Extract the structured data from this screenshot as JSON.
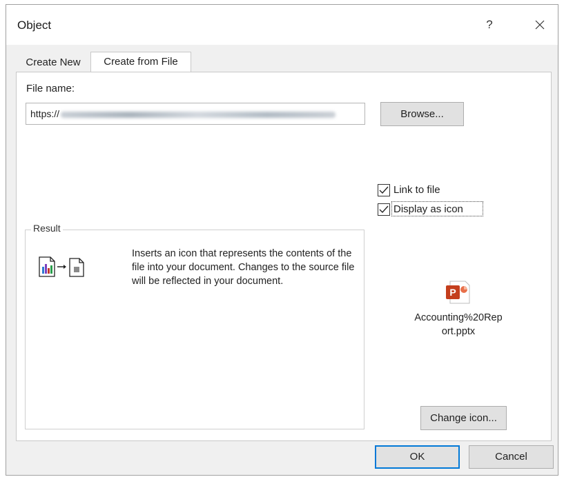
{
  "window": {
    "title": "Object",
    "help_label": "?"
  },
  "tabs": [
    {
      "label": "Create New",
      "selected": false
    },
    {
      "label": "Create from File",
      "selected": true
    }
  ],
  "file": {
    "label": "File name:",
    "value_visible": "https://",
    "browse_label": "Browse..."
  },
  "options": {
    "link_to_file": {
      "label": "Link to file",
      "checked": true
    },
    "display_as_icon": {
      "label": "Display as icon",
      "checked": true
    }
  },
  "result": {
    "label": "Result",
    "description": "Inserts an icon that represents the contents of the file into your document. Changes to the source file will be reflected in your document."
  },
  "icon_preview": {
    "caption_line1": "Accounting%20Rep",
    "caption_line2": "ort.pptx",
    "change_icon_label": "Change icon...",
    "icon": "powerpoint-file-icon"
  },
  "footer": {
    "ok_label": "OK",
    "cancel_label": "Cancel"
  },
  "colors": {
    "accent": "#0078d7",
    "ppt": "#c43e1c"
  }
}
